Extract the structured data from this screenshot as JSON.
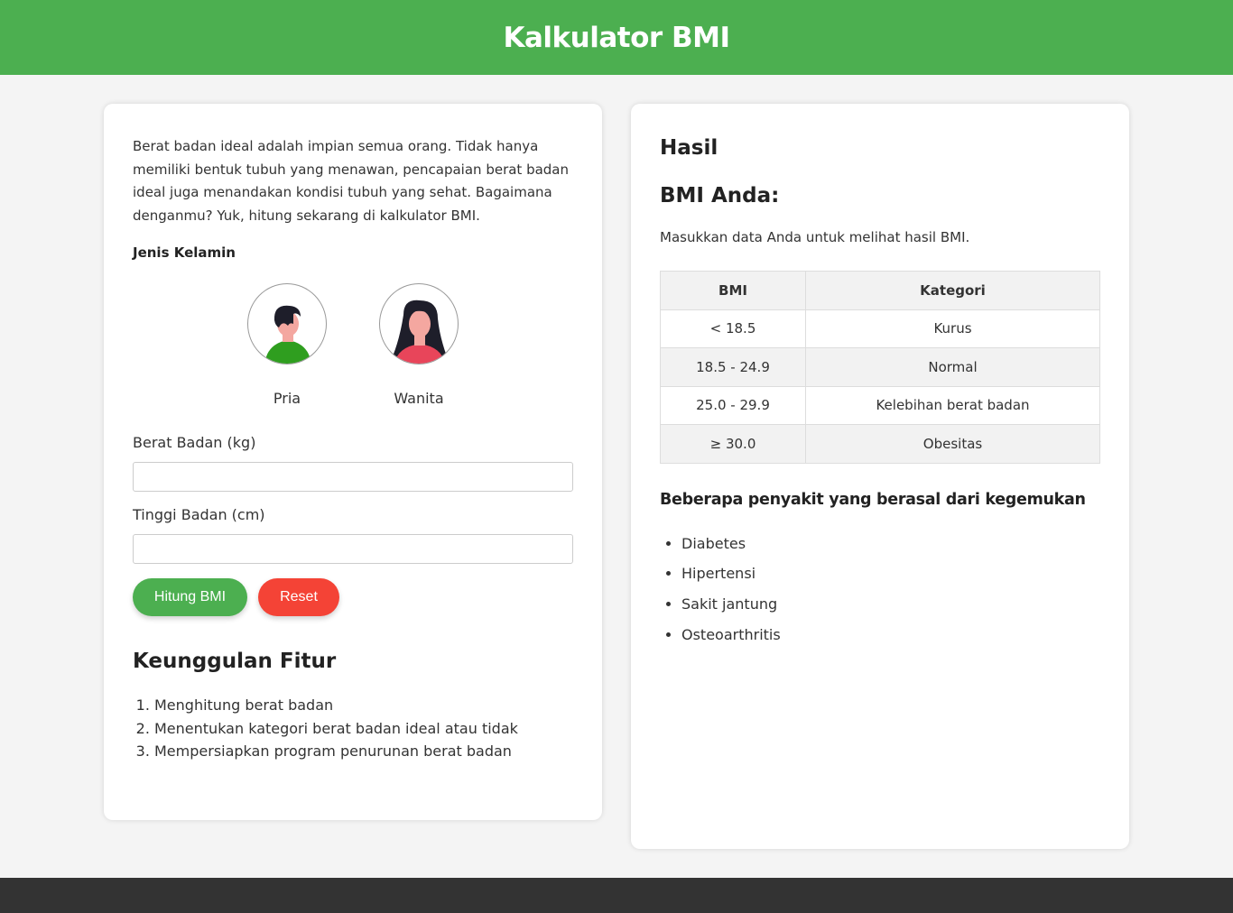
{
  "header": {
    "title": "Kalkulator BMI"
  },
  "form": {
    "intro": "Berat badan ideal adalah impian semua orang. Tidak hanya memiliki bentuk tubuh yang menawan, pencapaian berat badan ideal juga menandakan kondisi tubuh yang sehat. Bagaimana denganmu? Yuk, hitung sekarang di kalkulator BMI.",
    "gender_label": "Jenis Kelamin",
    "genders": [
      {
        "label": "Pria",
        "icon": "male-avatar-icon"
      },
      {
        "label": "Wanita",
        "icon": "female-avatar-icon"
      }
    ],
    "weight_label": "Berat Badan (kg)",
    "weight_value": "",
    "height_label": "Tinggi Badan (cm)",
    "height_value": "",
    "calc_button": "Hitung BMI",
    "reset_button": "Reset"
  },
  "features": {
    "title": "Keunggulan Fitur",
    "items": [
      "Menghitung berat badan",
      "Menentukan kategori berat badan ideal atau tidak",
      "Mempersiapkan program penurunan berat badan"
    ]
  },
  "result": {
    "title": "Hasil",
    "bmi_heading": "BMI Anda:",
    "message": "Masukkan data Anda untuk melihat hasil BMI.",
    "table": {
      "headers": [
        "BMI",
        "Kategori"
      ],
      "rows": [
        [
          "< 18.5",
          "Kurus"
        ],
        [
          "18.5 - 24.9",
          "Normal"
        ],
        [
          "25.0 - 29.9",
          "Kelebihan berat badan"
        ],
        [
          "≥ 30.0",
          "Obesitas"
        ]
      ]
    },
    "disease_heading": "Beberapa penyakit yang berasal dari kegemukan",
    "diseases": [
      "Diabetes",
      "Hipertensi",
      "Sakit jantung",
      "Osteoarthritis"
    ]
  },
  "colors": {
    "brand": "#4caf50",
    "danger": "#f44336",
    "footer": "#333333"
  }
}
